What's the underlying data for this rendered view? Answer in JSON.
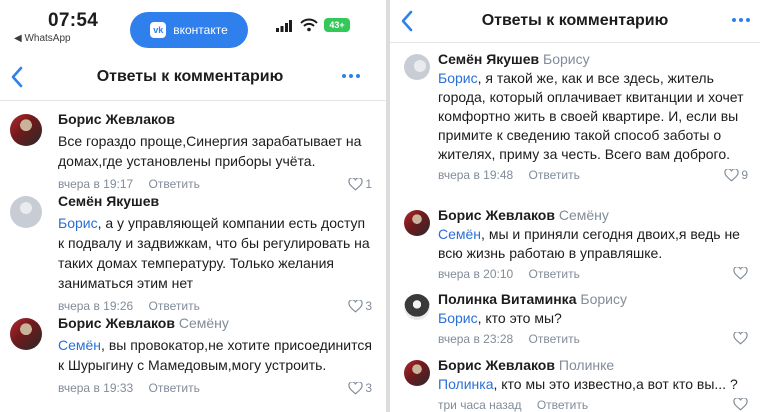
{
  "status_bar": {
    "time": "07:54",
    "back_app": "◀ WhatsApp",
    "pill_label": "вконтакте",
    "pill_logo": "vk",
    "battery": "43+"
  },
  "header": {
    "title": "Ответы к комментарию"
  },
  "reply_label": "Ответить",
  "left_comments": [
    {
      "author": "Борис Жевлаков",
      "reply_to": "",
      "mention": "",
      "text": "Все гораздо проще,Синергия зарабатывает на домах,где установлены приборы учёта.",
      "time": "вчера в 19:17",
      "likes": "1",
      "avatar": "boris-avatar"
    },
    {
      "author": "Семён Якушев",
      "reply_to": "",
      "mention": "Борис",
      "text": ", а у управляющей компании есть доступ к подвалу и задвижкам, что бы регулировать на таких домах температуру. Только желания заниматься этим нет",
      "time": "вчера в 19:26",
      "likes": "3",
      "avatar": "semen-avatar"
    },
    {
      "author": "Борис Жевлаков",
      "reply_to": "Семёну",
      "mention": "Семён",
      "text": ", вы провокатор,не хотите присоединится к Шурыгину с Мамедовым,могу устроить.",
      "time": "вчера в 19:33",
      "likes": "3",
      "avatar": "boris-avatar"
    }
  ],
  "right_comments": [
    {
      "author": "Семён Якушев",
      "reply_to": "Борису",
      "mention": "Борис",
      "text": ", я такой же, как и все здесь, житель города, который оплачивает квитанции и хочет комфортно жить в своей квартире. И, если вы примите к сведению такой способ заботы о жителях, приму за честь. Всего вам доброго.",
      "time": "вчера в 19:48",
      "likes": "9",
      "avatar": "semen-avatar"
    },
    {
      "author": "Борис Жевлаков",
      "reply_to": "Семёну",
      "mention": "Семён",
      "text": ", мы и приняли сегодня двоих,я ведь не всю жизнь работаю в управляшке.",
      "time": "вчера в 20:10",
      "likes": "",
      "avatar": "boris-avatar"
    },
    {
      "author": "Полинка Витаминка",
      "reply_to": "Борису",
      "mention": "Борис",
      "text": ", кто это мы?",
      "time": "вчера в 23:28",
      "likes": "",
      "avatar": "polina-avatar"
    },
    {
      "author": "Борис Жевлаков",
      "reply_to": "Полинке",
      "mention": "Полинка",
      "text": ", кто мы это известно,а вот кто вы... ?",
      "time": "три часа назад",
      "likes": "",
      "avatar": "boris-avatar"
    }
  ],
  "colors": {
    "accent": "#2f80ed",
    "mention": "#2a6fd6",
    "secondary_text": "#818c99",
    "battery": "#34c759"
  }
}
